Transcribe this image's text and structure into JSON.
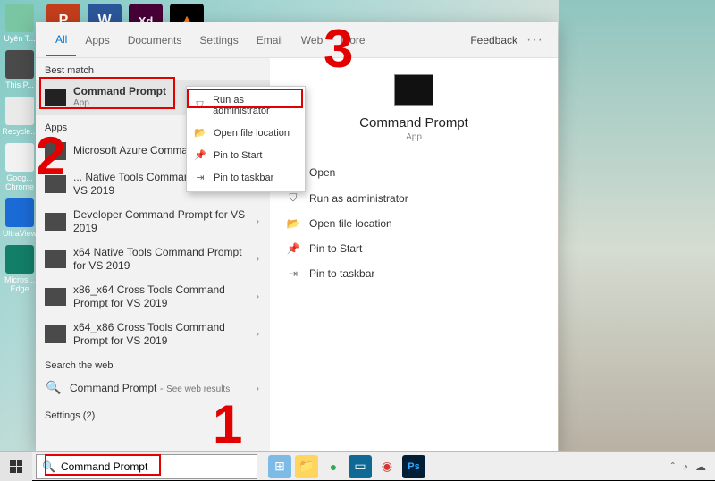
{
  "annotations": {
    "num1": "1",
    "num2": "2",
    "num3": "3"
  },
  "desktop_icons": [
    {
      "label": "Uyên T...",
      "color": "#7AC5A2"
    },
    {
      "label": "This P...",
      "color": "#4A4A4A"
    },
    {
      "label": "Recycle...",
      "color": "#EAEAEA"
    },
    {
      "label": "Goog... Chrome",
      "color": "#F2F2F2"
    },
    {
      "label": "UltraView",
      "color": "#1B6BD6"
    },
    {
      "label": "Micros... Edge",
      "color": "#137F68"
    }
  ],
  "top_apps": [
    {
      "glyph": "P",
      "color": "#C43E1C"
    },
    {
      "glyph": "W",
      "color": "#2B579A"
    },
    {
      "glyph": "Xd",
      "color": "#470137"
    },
    {
      "glyph": "▲",
      "color": "#000000"
    }
  ],
  "search": {
    "tabs": [
      "All",
      "Apps",
      "Documents",
      "Settings",
      "Email",
      "Web",
      "More"
    ],
    "active_tab": "All",
    "feedback": "Feedback",
    "best_match_label": "Best match",
    "apps_label": "Apps",
    "search_web_label": "Search the web",
    "settings_label": "Settings (2)",
    "best": {
      "title": "Command Prompt",
      "sub": "App"
    },
    "apps": [
      {
        "title": "Microsoft Azure Command P... .9"
      },
      {
        "title": "... Native Tools Command Prompt for VS 2019"
      },
      {
        "title": "Developer Command Prompt for VS 2019"
      },
      {
        "title": "x64 Native Tools Command Prompt for VS 2019"
      },
      {
        "title": "x86_x64 Cross Tools Command Prompt for VS 2019"
      },
      {
        "title": "x64_x86 Cross Tools Command Prompt for VS 2019"
      }
    ],
    "web_result": {
      "title": "Command Prompt",
      "sub": "See web results"
    },
    "context_menu": [
      {
        "icon": "⛉",
        "label": "Run as administrator"
      },
      {
        "icon": "📂",
        "label": "Open file location"
      },
      {
        "icon": "📌",
        "label": "Pin to Start"
      },
      {
        "icon": "⇥",
        "label": "Pin to taskbar"
      }
    ]
  },
  "preview": {
    "title": "Command Prompt",
    "sub": "App",
    "actions": [
      {
        "icon": "▢",
        "label": "Open"
      },
      {
        "icon": "⛉",
        "label": "Run as administrator"
      },
      {
        "icon": "📂",
        "label": "Open file location"
      },
      {
        "icon": "📌",
        "label": "Pin to Start"
      },
      {
        "icon": "⇥",
        "label": "Pin to taskbar"
      }
    ]
  },
  "taskbar": {
    "search_value": "Command Prompt",
    "pinned": [
      {
        "glyph": "⊞",
        "color": "#7DBBE6"
      },
      {
        "glyph": "📁",
        "color": "#FFD560"
      },
      {
        "glyph": "●",
        "color": "#34A853"
      },
      {
        "glyph": "▭",
        "color": "#0E6A94"
      },
      {
        "glyph": "◉",
        "color": "#D73434"
      },
      {
        "glyph": "Ps",
        "color": "#001E36"
      }
    ],
    "tray": [
      "ˆ",
      "◔",
      "☁"
    ]
  }
}
